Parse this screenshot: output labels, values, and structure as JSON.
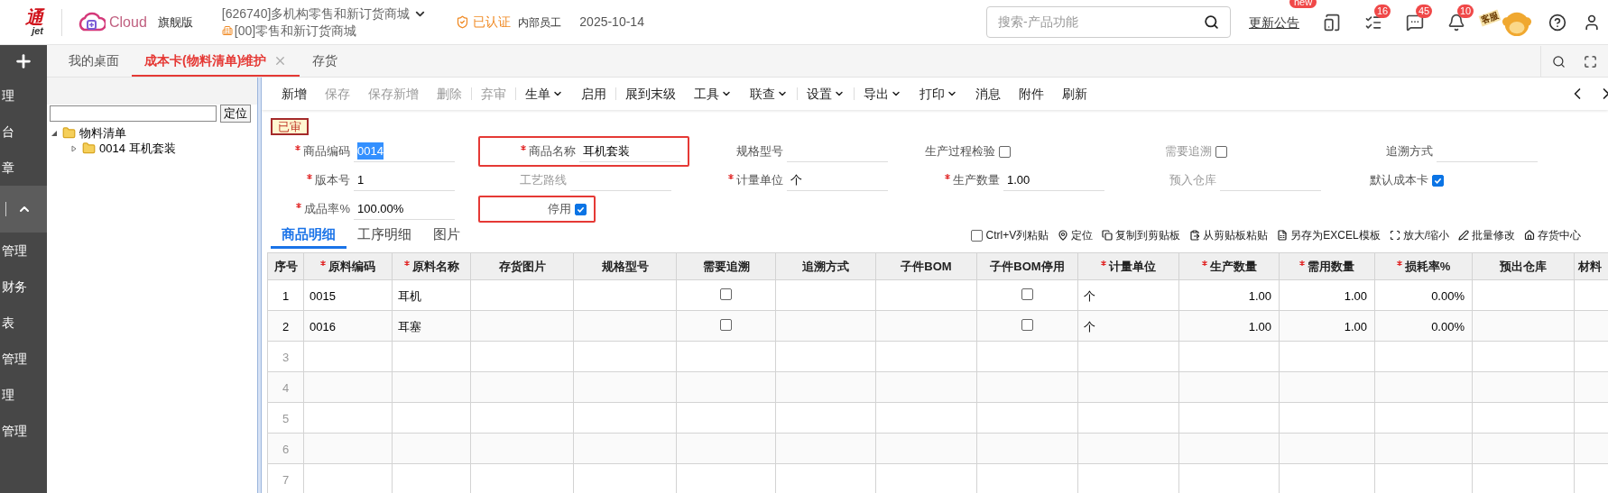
{
  "header": {
    "logo_text": "通",
    "logo_subtext": "jet",
    "product": "Cloud",
    "edition": "旗舰版",
    "company": "[626740]多机构零售和新订货商城",
    "org": "[00]零售和新订货商城",
    "certified": "已认证",
    "role": "内部员工",
    "date": "2025-10-14",
    "search": {
      "placeholder": "搜索-产品功能"
    },
    "notice": "更新公告",
    "notice_badge": "new",
    "icons": [
      {
        "kind": "device"
      },
      {
        "kind": "tasks",
        "badge": "16"
      },
      {
        "kind": "message",
        "badge": "45"
      },
      {
        "kind": "bell",
        "badge": "10"
      }
    ],
    "service": "客服"
  },
  "sidebar": {
    "items": [
      {
        "label": "理",
        "selected": false
      },
      {
        "label": "台",
        "selected": false
      },
      {
        "label": "章",
        "selected": false
      },
      {
        "kind": "collapse",
        "selected": true
      },
      {
        "label": "管理",
        "selected": false
      },
      {
        "label": "财务",
        "selected": false
      },
      {
        "label": "表",
        "selected": false
      },
      {
        "label": "管理",
        "selected": false
      },
      {
        "label": "理",
        "selected": false
      },
      {
        "label": "管理",
        "selected": false
      }
    ]
  },
  "tabs": [
    {
      "label": "我的桌面",
      "selected": false
    },
    {
      "label": "成本卡(物料清单)维护",
      "selected": true,
      "closable": true
    },
    {
      "label": "存货",
      "selected": false
    }
  ],
  "tree": {
    "locate_button": "定位",
    "items": [
      {
        "label": "物料清单",
        "expanded": true,
        "children": [
          {
            "label": "0014 耳机套装",
            "expanded": false
          }
        ]
      }
    ]
  },
  "toolbar": [
    {
      "label": "新增",
      "disabled": false
    },
    {
      "label": "保存",
      "disabled": true
    },
    {
      "label": "保存新增",
      "disabled": true
    },
    {
      "label": "删除",
      "disabled": true
    },
    {
      "label": "弃审",
      "disabled": true,
      "divider_before": true
    },
    {
      "label": "生单",
      "disabled": false,
      "dropdown": true,
      "divider_before": true
    },
    {
      "label": "启用",
      "disabled": false
    },
    {
      "label": "展到末级",
      "disabled": false,
      "divider_before": true
    },
    {
      "label": "工具",
      "disabled": false,
      "dropdown": true
    },
    {
      "label": "联查",
      "disabled": false,
      "dropdown": true
    },
    {
      "label": "设置",
      "disabled": false,
      "dropdown": true,
      "divider_before": true
    },
    {
      "label": "导出",
      "disabled": false,
      "dropdown": true,
      "divider_before": true
    },
    {
      "label": "打印",
      "disabled": false,
      "dropdown": true
    },
    {
      "label": "消息",
      "disabled": false
    },
    {
      "label": "附件",
      "disabled": false
    },
    {
      "label": "刷新",
      "disabled": false
    }
  ],
  "status": "已审",
  "form_rows": [
    [
      {
        "kind": "text",
        "label": "商品编码",
        "required": true,
        "value": "0014",
        "value_selected": true
      },
      {
        "kind": "text",
        "label": "商品名称",
        "required": true,
        "value": "耳机套装",
        "highlighted": true
      },
      {
        "kind": "text",
        "label": "规格型号"
      },
      {
        "kind": "checkbox",
        "label": "生产过程检验",
        "checked": false
      },
      {
        "kind": "checkbox",
        "label": "需要追溯",
        "checked": false,
        "muted": true
      },
      {
        "kind": "text",
        "label": "追溯方式"
      }
    ],
    [
      {
        "kind": "text",
        "label": "版本号",
        "required": true,
        "value": "1"
      },
      {
        "kind": "text",
        "label": "工艺路线",
        "muted": true
      },
      {
        "kind": "text",
        "label": "计量单位",
        "required": true,
        "value": "个"
      },
      {
        "kind": "text",
        "label": "生产数量",
        "required": true,
        "value": "1.00"
      },
      {
        "kind": "text",
        "label": "预入仓库",
        "muted": true
      },
      {
        "kind": "checkbox",
        "label": "默认成本卡",
        "checked": true
      }
    ],
    [
      {
        "kind": "text",
        "label": "成品率%",
        "required": true,
        "value": "100.00%"
      },
      {
        "kind": "checkbox",
        "label": "停用",
        "checked": true,
        "highlighted": true
      }
    ]
  ],
  "detail_tabs": [
    {
      "label": "商品明细",
      "selected": true
    },
    {
      "label": "工序明细",
      "selected": false
    },
    {
      "label": "图片",
      "selected": false
    }
  ],
  "grid_tools": [
    {
      "kind": "checkbox",
      "label": "Ctrl+V列粘贴",
      "checked": false
    },
    {
      "kind": "pin",
      "label": "定位"
    },
    {
      "kind": "copy",
      "label": "复制到剪贴板"
    },
    {
      "kind": "paste",
      "label": "从剪贴板粘贴"
    },
    {
      "kind": "excel",
      "label": "另存为EXCEL模板"
    },
    {
      "kind": "zoom",
      "label": "放大/缩小"
    },
    {
      "kind": "edit",
      "label": "批量修改"
    },
    {
      "kind": "home",
      "label": "存货中心"
    }
  ],
  "table": {
    "columns": [
      {
        "label": "序号"
      },
      {
        "label": "原料编码",
        "required": true
      },
      {
        "label": "原料名称",
        "required": true
      },
      {
        "label": "存货图片"
      },
      {
        "label": "规格型号"
      },
      {
        "label": "需要追溯",
        "kind": "checkbox"
      },
      {
        "label": "追溯方式"
      },
      {
        "label": "子件BOM"
      },
      {
        "label": "子件BOM停用",
        "kind": "checkbox"
      },
      {
        "label": "计量单位",
        "required": true
      },
      {
        "label": "生产数量",
        "required": true,
        "numeric": true
      },
      {
        "label": "需用数量",
        "required": true,
        "numeric": true
      },
      {
        "label": "损耗率%",
        "required": true,
        "numeric": true
      },
      {
        "label": "预出仓库"
      },
      {
        "label": "材料"
      }
    ],
    "rows": [
      {
        "cells": [
          "1",
          "0015",
          "耳机",
          null,
          null,
          {
            "checked": false
          },
          null,
          null,
          {
            "checked": false
          },
          "个",
          "1.00",
          "1.00",
          "0.00%",
          null,
          null
        ]
      },
      {
        "cells": [
          "2",
          "0016",
          "耳塞",
          null,
          null,
          {
            "checked": false
          },
          null,
          null,
          {
            "checked": false
          },
          "个",
          "1.00",
          "1.00",
          "0.00%",
          null,
          null
        ]
      },
      {
        "cells": [
          "3"
        ]
      },
      {
        "cells": [
          "4"
        ]
      },
      {
        "cells": [
          "5"
        ]
      },
      {
        "cells": [
          "6"
        ]
      },
      {
        "cells": [
          "7"
        ]
      }
    ]
  }
}
